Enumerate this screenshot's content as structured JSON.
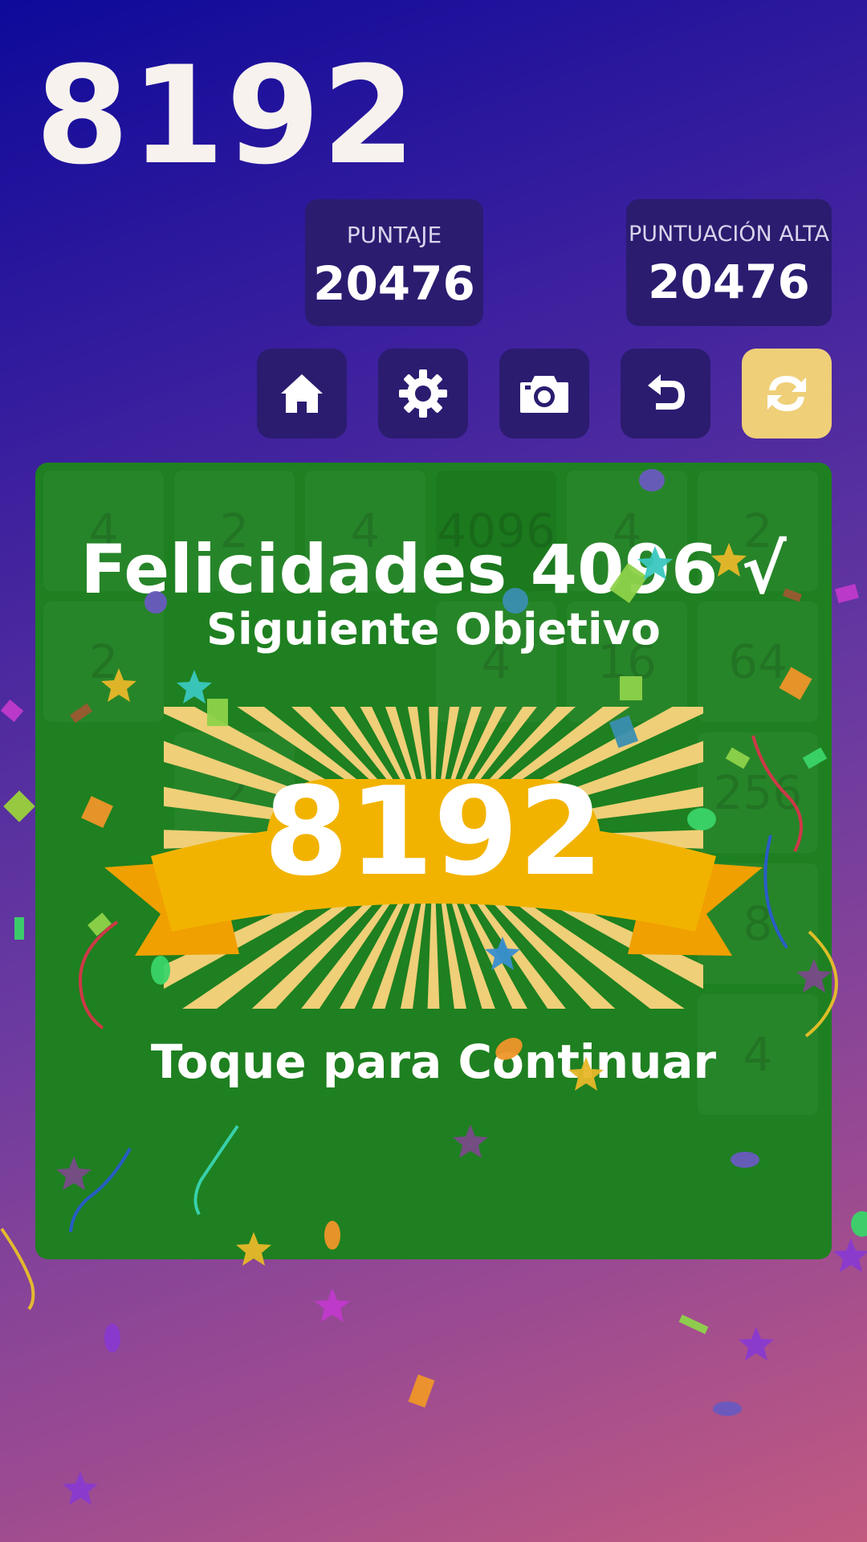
{
  "header": {
    "title": "8192"
  },
  "scores": {
    "score_label": "PUNTAJE",
    "score_value": "20476",
    "best_label": "PUNTUACIÓN ALTA",
    "best_value": "20476"
  },
  "toolbar": {
    "home_icon": "home-icon",
    "settings_icon": "gear-icon",
    "screenshot_icon": "camera-icon",
    "undo_icon": "undo-icon",
    "restart_icon": "refresh-icon",
    "accent": "#efcf78"
  },
  "board": {
    "background": "#1e8020",
    "tiles": [
      "4",
      "2",
      "4",
      "4096",
      "4",
      "2",
      "2",
      "4",
      "16",
      "64",
      "2",
      "256",
      "8",
      "4"
    ]
  },
  "overlay": {
    "congrats": "Felicidades 4096 √",
    "next_goal": "Siguiente Objetivo",
    "target": "8192",
    "tap_continue": "Toque para Continuar",
    "ribbon_color": "#f2b300"
  }
}
